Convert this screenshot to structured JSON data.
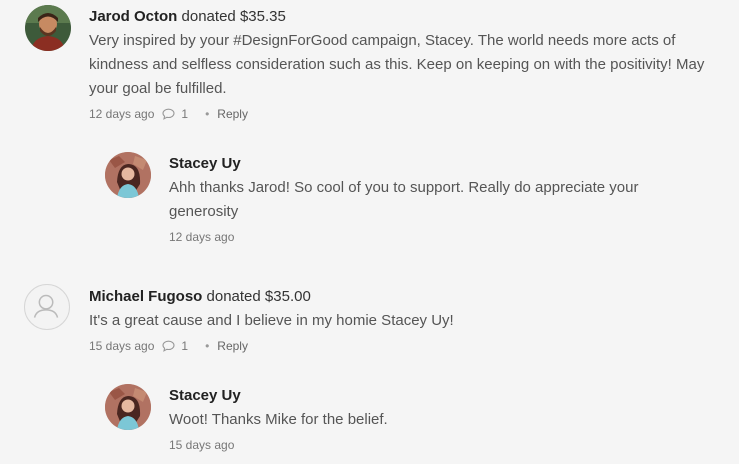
{
  "comments": [
    {
      "author": "Jarod Octon",
      "donated_word": "donated",
      "amount": "$35.35",
      "text": "Very inspired by your #DesignForGood campaign, Stacey. The world needs more acts of kindness and selfless consideration such as this. Keep on keeping on with the positivity! May your goal be fulfilled.",
      "time": "12 days ago",
      "reply_count": "1",
      "reply_label": "Reply",
      "replies": [
        {
          "author": "Stacey Uy",
          "text": "Ahh thanks Jarod! So cool of you to support. Really do appreciate your generosity",
          "time": "12 days ago"
        }
      ]
    },
    {
      "author": "Michael Fugoso",
      "donated_word": "donated",
      "amount": "$35.00",
      "text": "It's a great cause and I believe in my homie Stacey Uy!",
      "time": "15 days ago",
      "reply_count": "1",
      "reply_label": "Reply",
      "replies": [
        {
          "author": "Stacey Uy",
          "text": "Woot! Thanks Mike for the belief.",
          "time": "15 days ago"
        }
      ]
    }
  ],
  "icons": {
    "comment_bubble": "speech-bubble-icon",
    "default_avatar": "user-silhouette-icon"
  },
  "colors": {
    "background": "#f5f5f5",
    "text": "#555555",
    "meta": "#777777"
  }
}
